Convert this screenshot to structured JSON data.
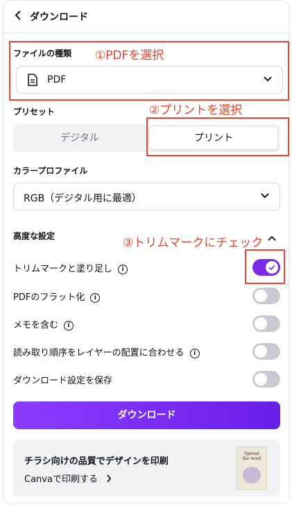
{
  "header": {
    "back_icon": "chevron-left-icon",
    "title": "ダウンロード"
  },
  "file_type": {
    "label": "ファイルの種類",
    "value": "PDF",
    "icon": "document-icon"
  },
  "preset": {
    "label": "プリセット",
    "options": [
      "デジタル",
      "プリント"
    ],
    "selected": "プリント"
  },
  "color_profile": {
    "label": "カラープロファイル",
    "value": "RGB（デジタル用に最適）"
  },
  "advanced": {
    "label": "高度な設定",
    "options": [
      {
        "label": "トリムマークと塗り足し",
        "info": true,
        "on": true
      },
      {
        "label": "PDFのフラット化",
        "info": true,
        "on": false
      },
      {
        "label": "メモを含む",
        "info": true,
        "on": false
      },
      {
        "label": "読み取り順序をレイヤーの配置に合わせる",
        "info": true,
        "on": false
      },
      {
        "label": "ダウンロード設定を保存",
        "info": false,
        "on": false
      }
    ]
  },
  "download_button": "ダウンロード",
  "promo": {
    "title": "チラシ向けの品質でデザインを印刷",
    "link": "Canvaで印刷する",
    "link_icon": "chevron-right-icon",
    "thumb_text_1": "Spread",
    "thumb_text_2": "the word"
  },
  "annotations": {
    "step1": "①PDFを選択",
    "step2": "②プリントを選択",
    "step3": "③トリムマークにチェック"
  },
  "colors": {
    "accent": "#7d2ae8",
    "annotation": "#e8412c"
  }
}
